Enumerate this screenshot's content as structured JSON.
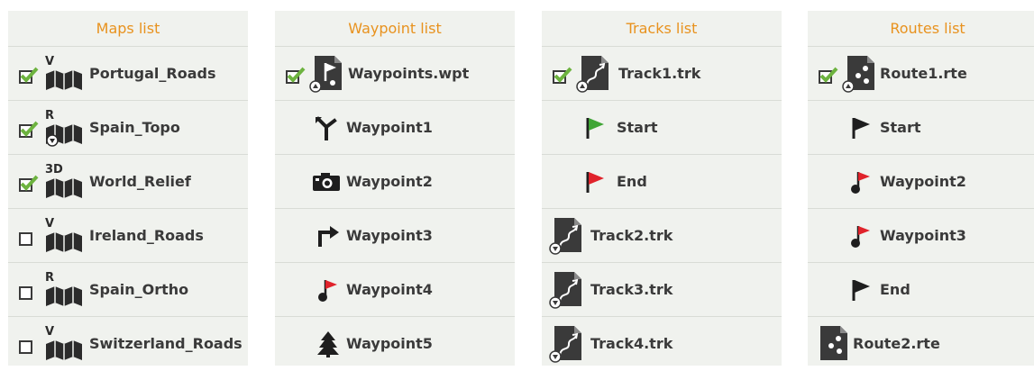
{
  "colors": {
    "header_text": "#e8921e",
    "panel_bg": "#f0f2ee",
    "check_green": "#6db33f",
    "icon_dark": "#3a3a3a",
    "flag_green": "#3fa535",
    "flag_red": "#e0232b"
  },
  "maps": {
    "title": "Maps list",
    "items": [
      {
        "label": "Portugal_Roads",
        "checked": true,
        "badge": "V",
        "icon": "map-folded-icon"
      },
      {
        "label": "Spain_Topo",
        "checked": true,
        "badge": "R",
        "icon": "map-folded-icon"
      },
      {
        "label": "World_Relief",
        "checked": true,
        "badge": "3D",
        "icon": "map-folded-icon"
      },
      {
        "label": "Ireland_Roads",
        "checked": false,
        "badge": "V",
        "icon": "map-folded-icon"
      },
      {
        "label": "Spain_Ortho",
        "checked": false,
        "badge": "R",
        "icon": "map-folded-icon"
      },
      {
        "label": "Switzerland_Roads",
        "checked": false,
        "badge": "V",
        "icon": "map-folded-icon"
      }
    ]
  },
  "waypoints": {
    "title": "Waypoint list",
    "file": {
      "label": "Waypoints.wpt",
      "checked": true,
      "icon": "waypoint-file-icon"
    },
    "items": [
      {
        "label": "Waypoint1",
        "icon": "fork-sign-icon"
      },
      {
        "label": "Waypoint2",
        "icon": "camera-icon"
      },
      {
        "label": "Waypoint3",
        "icon": "turn-right-icon"
      },
      {
        "label": "Waypoint4",
        "icon": "pin-flag-icon"
      },
      {
        "label": "Waypoint5",
        "icon": "tree-icon"
      }
    ]
  },
  "tracks": {
    "title": "Tracks list",
    "files": [
      {
        "label": "Track1.trk",
        "checked": true,
        "expanded": true,
        "icon": "track-file-icon",
        "children": [
          {
            "label": "Start",
            "icon": "green-flag-icon"
          },
          {
            "label": "End",
            "icon": "red-flag-icon"
          }
        ]
      },
      {
        "label": "Track2.trk",
        "checked": false,
        "expanded": false,
        "icon": "track-file-icon"
      },
      {
        "label": "Track3.trk",
        "checked": false,
        "expanded": false,
        "icon": "track-file-icon"
      },
      {
        "label": "Track4.trk",
        "checked": false,
        "expanded": false,
        "icon": "track-file-icon"
      }
    ]
  },
  "routes": {
    "title": "Routes list",
    "files": [
      {
        "label": "Route1.rte",
        "checked": true,
        "expanded": true,
        "icon": "route-file-icon",
        "children": [
          {
            "label": "Start",
            "icon": "black-flag-icon"
          },
          {
            "label": "Waypoint2",
            "icon": "pin-flag-icon"
          },
          {
            "label": "Waypoint3",
            "icon": "pin-flag-icon"
          },
          {
            "label": "End",
            "icon": "black-flag-icon"
          }
        ]
      },
      {
        "label": "Route2.rte",
        "checked": false,
        "expanded": false,
        "icon": "route-file-icon"
      }
    ]
  }
}
